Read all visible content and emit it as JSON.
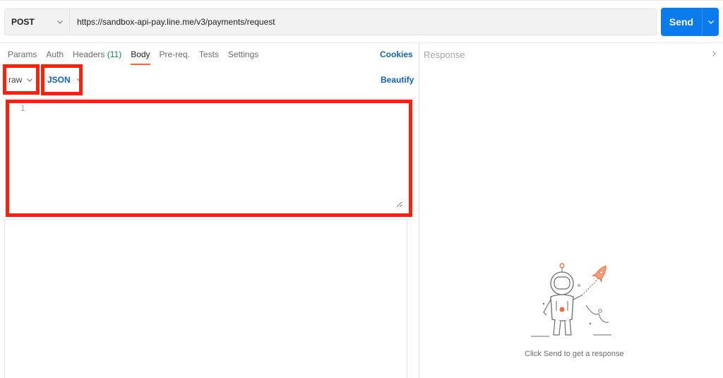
{
  "request": {
    "method": "POST",
    "url": "https://sandbox-api-pay.line.me/v3/payments/request",
    "send_label": "Send"
  },
  "tabs": [
    {
      "label": "Params"
    },
    {
      "label": "Auth"
    },
    {
      "label": "Headers",
      "count": "(11)"
    },
    {
      "label": "Body"
    },
    {
      "label": "Pre-req."
    },
    {
      "label": "Tests"
    },
    {
      "label": "Settings"
    }
  ],
  "active_tab": "Body",
  "cookies_label": "Cookies",
  "body": {
    "mode": "raw",
    "language": "JSON",
    "beautify_label": "Beautify",
    "line_numbers": [
      "1"
    ],
    "content": ""
  },
  "response": {
    "title": "Response",
    "hint": "Click Send to get a response"
  },
  "icons": {
    "method_dropdown": "chevron-down-icon",
    "send_dropdown": "chevron-down-icon",
    "response_collapse": "chevron-right-icon",
    "illustration": "astronaut-rocket-icon"
  },
  "colors": {
    "accent_blue": "#097bed",
    "link_blue": "#0b63c5",
    "active_tab_underline": "#f26b3a",
    "headers_count_green": "#0c8a3c",
    "highlight_red": "#ff1f0d"
  }
}
